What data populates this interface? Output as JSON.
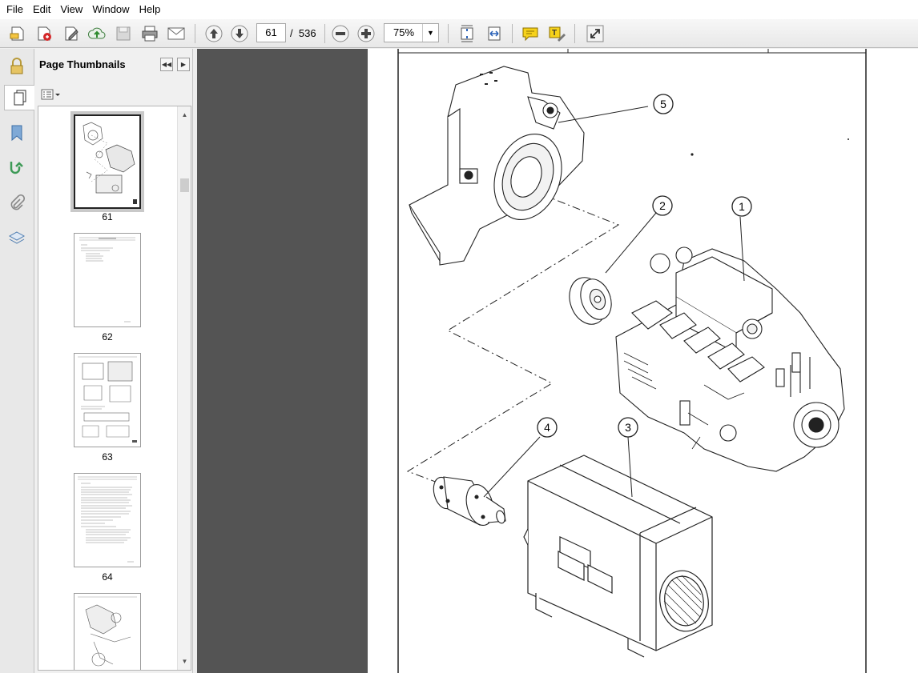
{
  "menu": {
    "file": "File",
    "edit": "Edit",
    "view": "View",
    "window": "Window",
    "help": "Help"
  },
  "toolbar": {
    "page_current": "61",
    "page_separator": "/",
    "page_total": "536",
    "zoom": "75%"
  },
  "panel": {
    "title": "Page Thumbnails",
    "thumbnails": [
      {
        "label": "61",
        "selected": true
      },
      {
        "label": "62",
        "selected": false
      },
      {
        "label": "63",
        "selected": false
      },
      {
        "label": "64",
        "selected": false
      }
    ]
  },
  "drawing": {
    "callouts": [
      "1",
      "2",
      "3",
      "4",
      "5"
    ]
  },
  "colors": {
    "doc_background": "#545454",
    "panel_background": "#f0f0f0",
    "menu_background": "#ffffff"
  }
}
